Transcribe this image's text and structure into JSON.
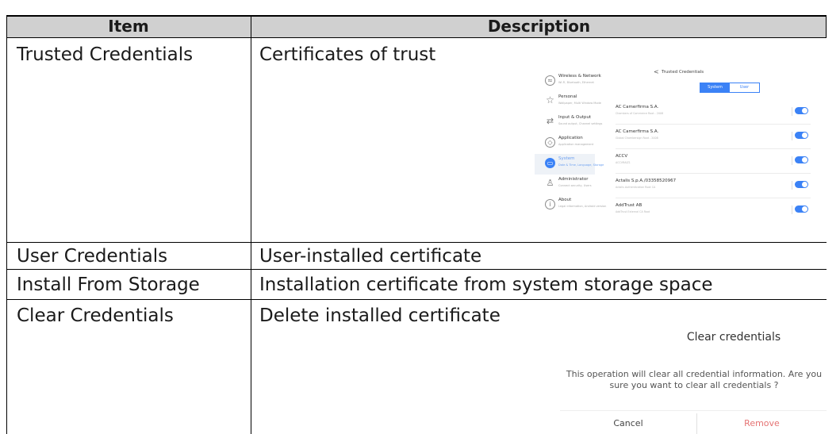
{
  "table": {
    "headers": {
      "item": "Item",
      "description": "Description"
    },
    "rows": [
      {
        "item": "Trusted Credentials",
        "description": "Certificates of trust"
      },
      {
        "item": "User Credentials",
        "description": "User-installed certificate"
      },
      {
        "item": "Install From Storage",
        "description": "Installation certificate from system storage space"
      },
      {
        "item": "Clear Credentials",
        "description": "Delete installed certificate"
      }
    ]
  },
  "settings_screenshot": {
    "menu": [
      {
        "title": "Wireless & Network",
        "sub": "Wi-Fi, Bluetooth, Ethernet",
        "icon": "wifi-icon"
      },
      {
        "title": "Personal",
        "sub": "Wallpaper, Multi Window Mode",
        "icon": "star-icon"
      },
      {
        "title": "Input & Output",
        "sub": "Sound output, Channel settings",
        "icon": "arrows-icon"
      },
      {
        "title": "Application",
        "sub": "Application management",
        "icon": "app-icon"
      },
      {
        "title": "System",
        "sub": "Date & Time, Language, Storage",
        "icon": "system-icon"
      },
      {
        "title": "Administrator",
        "sub": "Connect security, Users",
        "icon": "person-icon"
      },
      {
        "title": "About",
        "sub": "Legal information, Android version",
        "icon": "info-icon"
      }
    ],
    "active_menu_index": 4,
    "back_glyph": "<",
    "page_title": "Trusted Credentials",
    "tabs": [
      "System",
      "User"
    ],
    "selected_tab": "System",
    "certificates": [
      {
        "name": "AC Camerfirma S.A.",
        "detail": "Chambers of Commerce Root - 2008",
        "enabled": true
      },
      {
        "name": "AC Camerfirma S.A.",
        "detail": "Global Chambersign Root - 2008",
        "enabled": true
      },
      {
        "name": "ACCV",
        "detail": "ACCVRAIZ1",
        "enabled": true
      },
      {
        "name": "Actalis S.p.A./03358520967",
        "detail": "Actalis Authentication Root CA",
        "enabled": true
      },
      {
        "name": "AddTrust AB",
        "detail": "AddTrust External CA Root",
        "enabled": true
      }
    ],
    "accent_color": "#3b82f6"
  },
  "clear_dialog": {
    "title": "Clear credentials",
    "message_line1": "This operation will clear all credential information. Are you",
    "message_line2": "sure you want to clear all credentials ?",
    "cancel_label": "Cancel",
    "remove_label": "Remove",
    "remove_color": "#e57373"
  }
}
